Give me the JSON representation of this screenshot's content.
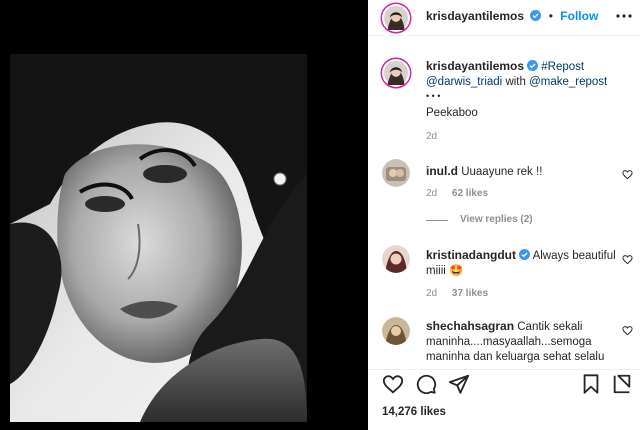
{
  "post": {
    "author": "krisdayantilemos",
    "follow_label": "Follow",
    "separator": "•"
  },
  "caption": {
    "username": "krisdayantilemos",
    "repost_tag": "#Repost",
    "mention_1": "@darwis_triadi",
    "with_word": "with",
    "mention_2": "@make_repost",
    "dots": "• • •",
    "text": "Peekaboo",
    "age": "2d"
  },
  "comments": [
    {
      "username": "inul.d",
      "text": "Uuaayune rek !!",
      "age": "2d",
      "likes": "62 likes",
      "view_replies": "View replies (2)"
    },
    {
      "username": "kristinadangdut",
      "text_line1": "Always beautiful",
      "text_line2": "miiii",
      "emoji": "🤩",
      "age": "2d",
      "likes": "37 likes"
    },
    {
      "username": "shechahsagran",
      "text_line1": "Cantik sekali",
      "text_line2": "maninha....masyaallah...semoga",
      "text_line3": "maninha dan keluarga sehat selalu"
    }
  ],
  "footer": {
    "likes": "14,276 likes"
  },
  "colors": {
    "follow_blue": "#0095f6",
    "verified_blue": "#3897f0",
    "text": "#262626",
    "muted": "#8e8e8e",
    "link": "#00376b"
  },
  "icons": [
    "verified-badge-icon",
    "heart-icon",
    "comment-icon",
    "share-icon",
    "bookmark-icon",
    "more-options-icon"
  ]
}
